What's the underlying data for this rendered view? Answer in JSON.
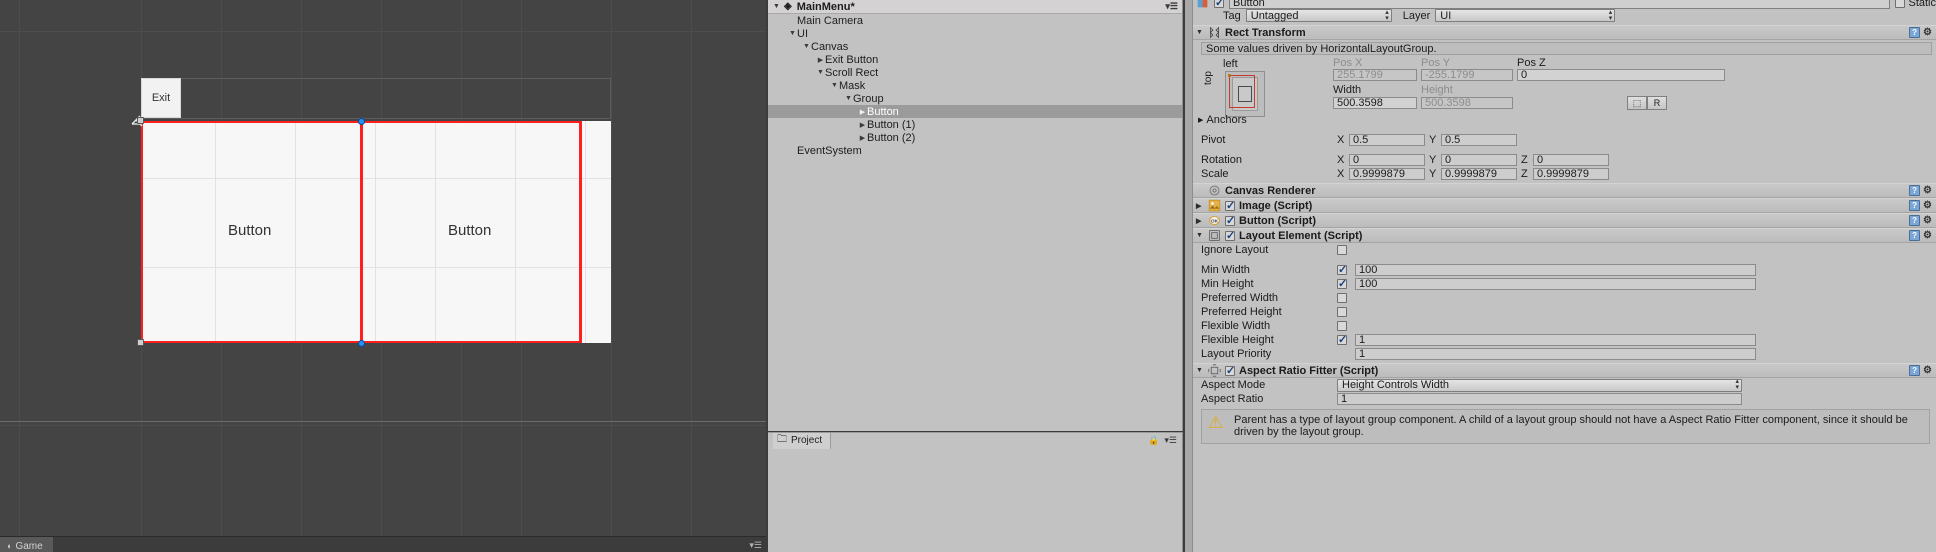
{
  "scene": {
    "exit_label": "Exit",
    "button_label_1": "Button",
    "button_label_2": "Button",
    "game_tab_label": "Game",
    "game_tab_icon": "game-icon"
  },
  "hierarchy": {
    "title": "MainMenu*",
    "menu_icon": "hamburger-icon",
    "items": [
      {
        "label": "Main Camera",
        "depth": 1,
        "arrow": "",
        "selected": false
      },
      {
        "label": "UI",
        "depth": 1,
        "arrow": "▼",
        "selected": false
      },
      {
        "label": "Canvas",
        "depth": 2,
        "arrow": "▼",
        "selected": false
      },
      {
        "label": "Exit Button",
        "depth": 3,
        "arrow": "▶",
        "selected": false
      },
      {
        "label": "Scroll Rect",
        "depth": 3,
        "arrow": "▼",
        "selected": false
      },
      {
        "label": "Mask",
        "depth": 4,
        "arrow": "▼",
        "selected": false
      },
      {
        "label": "Group",
        "depth": 5,
        "arrow": "▼",
        "selected": false
      },
      {
        "label": "Button",
        "depth": 6,
        "arrow": "▶",
        "selected": true
      },
      {
        "label": "Button (1)",
        "depth": 6,
        "arrow": "▶",
        "selected": false
      },
      {
        "label": "Button (2)",
        "depth": 6,
        "arrow": "▶",
        "selected": false
      },
      {
        "label": "EventSystem",
        "depth": 1,
        "arrow": "",
        "selected": false
      }
    ]
  },
  "project": {
    "tab_label": "Project",
    "tab_icon": "folder-icon",
    "lock_icon": "lock-icon",
    "menu_icon": "hamburger-icon"
  },
  "inspector": {
    "object_name": "Button",
    "static_label": "Static",
    "tag_label": "Tag",
    "tag_value": "Untagged",
    "layer_label": "Layer",
    "layer_value": "UI",
    "rect_transform": {
      "title": "Rect Transform",
      "driven_note": "Some values driven by HorizontalLayoutGroup.",
      "anchor_left_label": "left",
      "anchor_top_label": "top",
      "pos_x_label": "Pos X",
      "pos_x_value": "255.1799",
      "pos_y_label": "Pos Y",
      "pos_y_value": "-255.1799",
      "pos_z_label": "Pos Z",
      "pos_z_value": "0",
      "width_label": "Width",
      "width_value": "500.3598",
      "height_label": "Height",
      "height_value": "500.3598",
      "blueprint_button": "blueprint-icon",
      "raw_button": "R",
      "anchors_label": "Anchors",
      "pivot_label": "Pivot",
      "pivot_x": "0.5",
      "pivot_y": "0.5",
      "rotation_label": "Rotation",
      "rotation_x": "0",
      "rotation_y": "0",
      "rotation_z": "0",
      "scale_label": "Scale",
      "scale_x": "0.9999879",
      "scale_y": "0.9999879",
      "scale_z": "0.9999879"
    },
    "canvas_renderer": {
      "title": "Canvas Renderer"
    },
    "image_script": {
      "title": "Image (Script)",
      "enabled": true
    },
    "button_script": {
      "title": "Button (Script)",
      "enabled": true
    },
    "layout_element": {
      "title": "Layout Element (Script)",
      "enabled": true,
      "rows": [
        {
          "label": "Ignore Layout",
          "checked": false,
          "value": null,
          "has_field": false
        },
        {
          "label": "Min Width",
          "checked": true,
          "value": "100",
          "has_field": true
        },
        {
          "label": "Min Height",
          "checked": true,
          "value": "100",
          "has_field": true
        },
        {
          "label": "Preferred Width",
          "checked": false,
          "value": "",
          "has_field": false
        },
        {
          "label": "Preferred Height",
          "checked": false,
          "value": "",
          "has_field": false
        },
        {
          "label": "Flexible Width",
          "checked": false,
          "value": "",
          "has_field": false
        },
        {
          "label": "Flexible Height",
          "checked": true,
          "value": "1",
          "has_field": true
        }
      ],
      "priority_label": "Layout Priority",
      "priority_value": "1"
    },
    "aspect_ratio_fitter": {
      "title": "Aspect Ratio Fitter (Script)",
      "enabled": true,
      "aspect_mode_label": "Aspect Mode",
      "aspect_mode_value": "Height Controls Width",
      "aspect_ratio_label": "Aspect Ratio",
      "aspect_ratio_value": "1",
      "warning": "Parent has a type of layout group component. A child of a layout group should not have a Aspect Ratio Fitter component, since it should be driven by the layout group."
    },
    "help_icon": "help-icon",
    "gear_icon": "gear-icon",
    "foldout_open": "▼",
    "foldout_closed": "▶"
  },
  "colors": {
    "selection_red": "#ff1f1f",
    "handle_blue": "#2196f3",
    "panel_gray": "#c2c2c2",
    "scene_bg": "#444444",
    "warning_yellow": "#e3a81c"
  }
}
